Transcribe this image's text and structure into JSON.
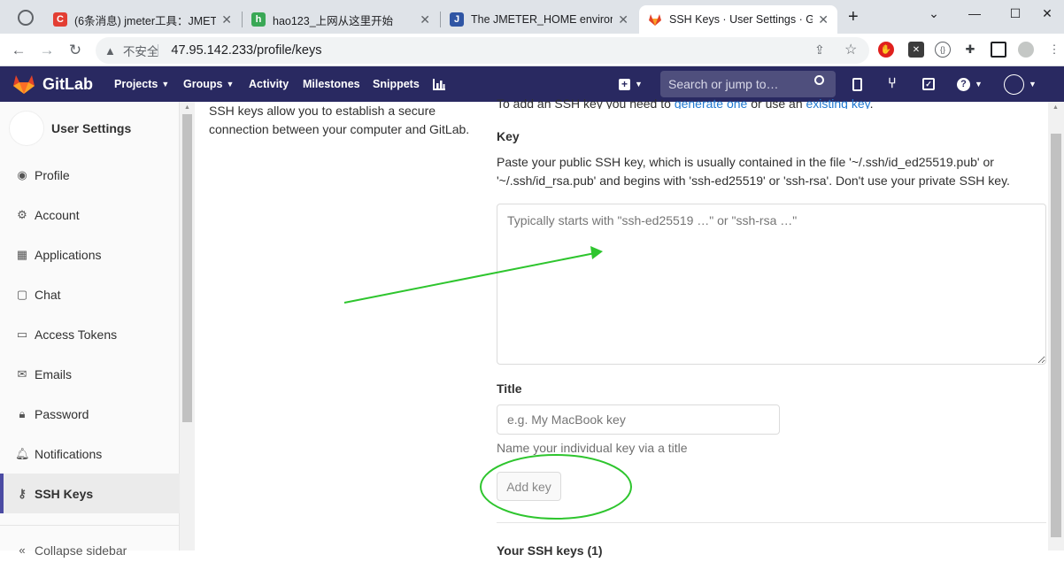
{
  "browser": {
    "tabs": [
      {
        "label": "(6条消息) jmeter工具：JMETI",
        "favicon": "C"
      },
      {
        "label": "hao123_上网从这里开始",
        "favicon": "h"
      },
      {
        "label": "The JMETER_HOME environ",
        "favicon": "J"
      },
      {
        "label": "SSH Keys · User Settings · G",
        "favicon": "gitlab"
      }
    ],
    "insecure_label": "不安全",
    "url": "47.95.142.233/profile/keys"
  },
  "gitlab": {
    "brand": "GitLab",
    "nav": [
      "Projects",
      "Groups",
      "Activity",
      "Milestones",
      "Snippets"
    ],
    "search_placeholder": "Search or jump to…"
  },
  "sidebar": {
    "title": "User Settings",
    "items": [
      {
        "label": "Profile",
        "icon": "profile-icon"
      },
      {
        "label": "Account",
        "icon": "account-icon"
      },
      {
        "label": "Applications",
        "icon": "applications-icon"
      },
      {
        "label": "Chat",
        "icon": "chat-icon"
      },
      {
        "label": "Access Tokens",
        "icon": "token-icon"
      },
      {
        "label": "Emails",
        "icon": "email-icon"
      },
      {
        "label": "Password",
        "icon": "lock-icon"
      },
      {
        "label": "Notifications",
        "icon": "bell-icon"
      },
      {
        "label": "SSH Keys",
        "icon": "key-icon"
      }
    ],
    "collapse_label": "Collapse sidebar"
  },
  "main": {
    "intro": "SSH keys allow you to establish a secure connection between your computer and GitLab.",
    "top_line": {
      "prefix": "To add an SSH key you need to ",
      "link1": "generate one",
      "middle": " or use an ",
      "link2": "existing key",
      "suffix": "."
    },
    "key_label": "Key",
    "key_help": "Paste your public SSH key, which is usually contained in the file '~/.ssh/id_ed25519.pub' or '~/.ssh/id_rsa.pub' and begins with 'ssh-ed25519' or 'ssh-rsa'. Don't use your private SSH key.",
    "key_placeholder": "Typically starts with \"ssh-ed25519 …\" or \"ssh-rsa …\"",
    "title_label": "Title",
    "title_placeholder": "e.g. My MacBook key",
    "title_help": "Name your individual key via a title",
    "add_button": "Add key",
    "your_keys": "Your SSH keys (1)"
  },
  "colors": {
    "header": "#292961",
    "annotation": "#2ec52e",
    "active_border": "#4b4ba3"
  }
}
